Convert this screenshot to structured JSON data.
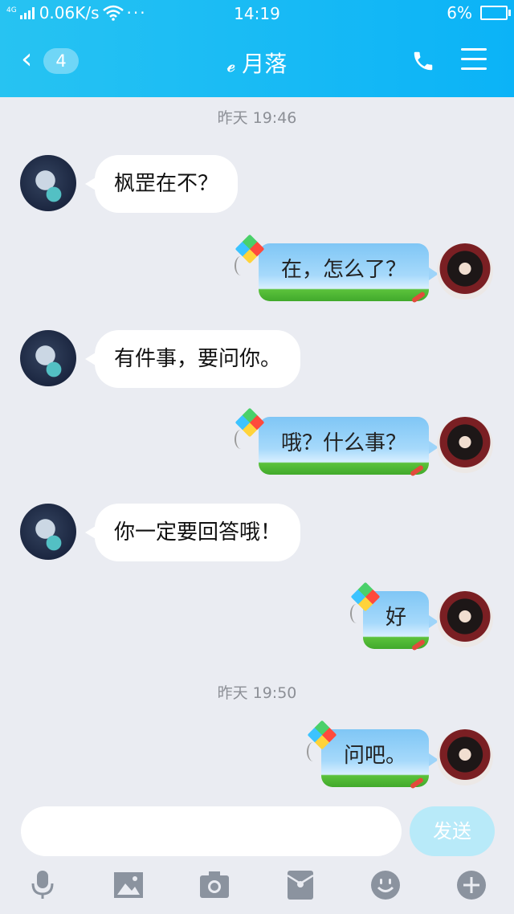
{
  "status_bar": {
    "network_type": "4G",
    "speed": "0.06K/s",
    "time": "14:19",
    "battery": "6%"
  },
  "header": {
    "back_count": "4",
    "contact_name": "月落"
  },
  "chat": {
    "timestamps": [
      "昨天 19:46",
      "昨天 19:50"
    ],
    "messages": [
      {
        "side": "left",
        "text": "枫罡在不？"
      },
      {
        "side": "right",
        "text": "在，怎么了？"
      },
      {
        "side": "left",
        "text": "有件事，要问你。"
      },
      {
        "side": "right",
        "text": "哦？什么事？"
      },
      {
        "side": "left",
        "text": "你一定要回答哦！"
      },
      {
        "side": "right",
        "text": "好"
      },
      {
        "side": "right",
        "text": "问吧。"
      }
    ]
  },
  "input": {
    "value": "",
    "send_label": "发送"
  },
  "toolbar": {
    "icons": [
      "microphone-icon",
      "image-icon",
      "camera-icon",
      "red-packet-icon",
      "emoji-icon",
      "plus-icon"
    ]
  },
  "colors": {
    "header": "#14b8f6",
    "background": "#eaecf2",
    "send_disabled": "#b8eaf9",
    "toolbar_icon": "#8b939f"
  }
}
